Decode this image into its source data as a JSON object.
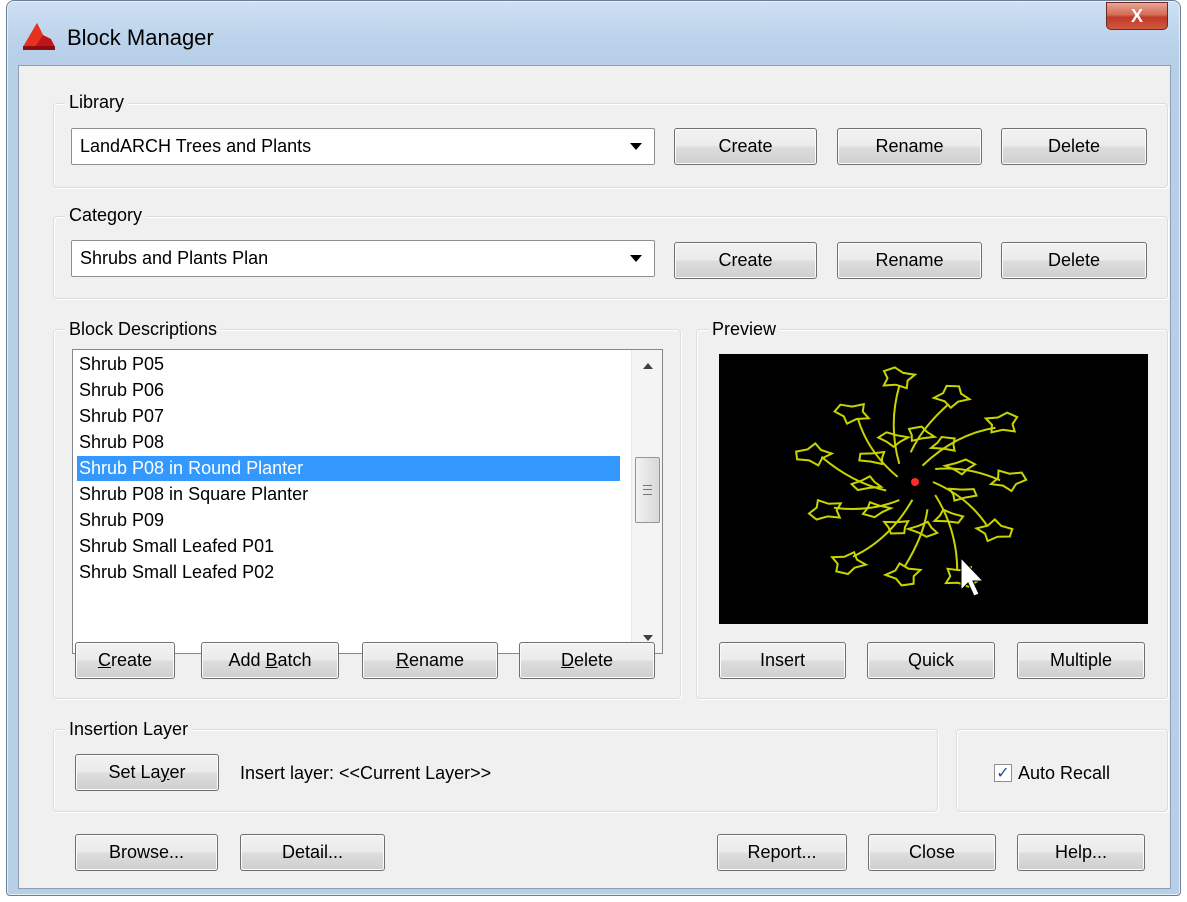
{
  "window": {
    "title": "Block Manager",
    "close_label": "X"
  },
  "library": {
    "label": "Library",
    "selected": "LandARCH Trees and Plants",
    "create": "Create",
    "rename": "Rename",
    "delete": "Delete"
  },
  "category": {
    "label": "Category",
    "selected": "Shrubs and Plants Plan",
    "create": "Create",
    "rename": "Rename",
    "delete": "Delete"
  },
  "block_descriptions": {
    "label": "Block Descriptions",
    "items": [
      "Shrub P05",
      "Shrub P06",
      "Shrub P07",
      "Shrub P08",
      "Shrub P08 in Round Planter",
      "Shrub P08 in Square Planter",
      "Shrub P09",
      "Shrub Small Leafed P01",
      "Shrub Small Leafed P02"
    ],
    "selected_index": 4,
    "buttons": {
      "create": {
        "pre": "",
        "u": "C",
        "post": "reate"
      },
      "add_batch": {
        "pre": "Add ",
        "u": "B",
        "post": "atch"
      },
      "rename": {
        "pre": "",
        "u": "R",
        "post": "ename"
      },
      "delete": {
        "pre": "",
        "u": "D",
        "post": "elete"
      }
    }
  },
  "preview": {
    "label": "Preview",
    "insert": "Insert",
    "quick": "Quick",
    "multiple": "Multiple",
    "line_color": "#c8d400",
    "base_point_color": "#ff2a2a"
  },
  "insertion_layer": {
    "label": "Insertion Layer",
    "set_layer": {
      "pre": "Set La",
      "u": "y",
      "post": "er"
    },
    "insert_layer_text": "Insert layer: <<Current Layer>>"
  },
  "auto_recall": {
    "label": "Auto Recall",
    "checked": true
  },
  "footer": {
    "browse": "Browse...",
    "detail": "Detail...",
    "report": "Report...",
    "close": "Close",
    "help": "Help..."
  }
}
